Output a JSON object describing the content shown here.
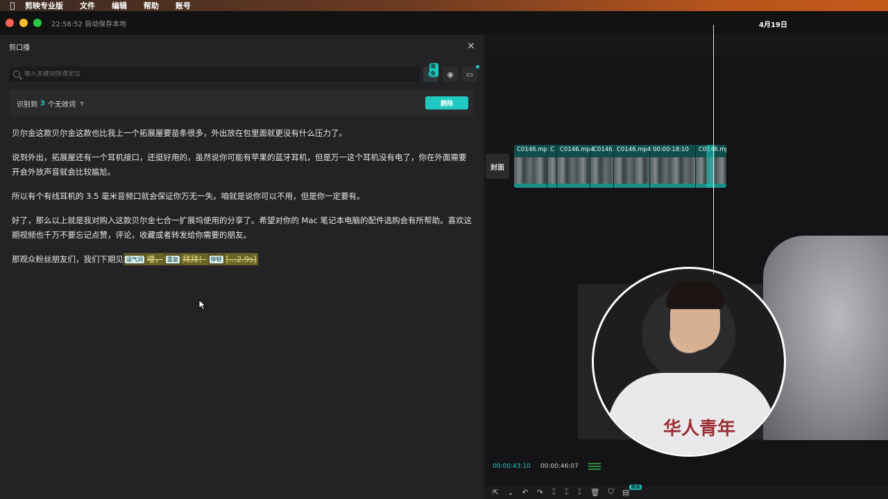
{
  "menubar": {
    "apple_icon": "apple-logo-icon",
    "app_name": "剪映专业版",
    "items": [
      "文件",
      "编辑",
      "帮助",
      "账号"
    ]
  },
  "titlebar": {
    "save_status": "22:58:52 自动保存本地",
    "date": "4月19日"
  },
  "panel": {
    "title": "剪口播",
    "search_placeholder": "输入关键词快速定位",
    "tool_badge": "限免",
    "detect_prefix": "识别到",
    "detect_count": "3",
    "detect_suffix": "个无效词",
    "delete_label": "删除"
  },
  "transcript": {
    "paragraphs": [
      "贝尔金这款贝尔金这款也比我上一个拓展屋要苗条很多，外出放在包里面就更没有什么压力了。",
      "说到外出，拓展屋还有一个耳机接口，还挺好用的，虽然说你可能有苹果的蓝牙耳机，但是万一这个耳机没有电了，你在外面需要开会外放声音就会比较尴尬。",
      "所以有个有线耳机的 3.5 毫米音频口就会保证你万无一失。咱就是说你可以不用，但是你一定要有。",
      "好了，那么以上就是我对购入这款贝尔金七合一扩展坞使用的分享了。希望对你的 Mac 笔记本电脑的配件选购会有所帮助。喜欢这期视频也千万不要忘记点赞，评论，收藏或者转发给你需要的朋友。"
    ],
    "last_line_text": "那观众粉丝朋友们，我们下期见",
    "filler_tag": "语气词",
    "filler_word": "喽，",
    "repeat_tag": "重复",
    "repeat_word": "拜拜！",
    "pause_tag": "停顿",
    "pause_word": "[...2.9s]"
  },
  "timeline": {
    "cover_label": "封面",
    "clips": [
      "C0146.mp",
      "C",
      "C0146.mp4",
      "C0146.",
      "C0146.mp4",
      "00:00:18:10",
      "C0146.mp"
    ]
  },
  "player": {
    "current_time": "00:00:43:10",
    "total_time": "00:00:46:07",
    "shirt_text": "华人青年"
  },
  "toolbar": {
    "badge": "限免"
  },
  "colors": {
    "accent": "#1fc9c1",
    "panel_bg": "#232325"
  }
}
